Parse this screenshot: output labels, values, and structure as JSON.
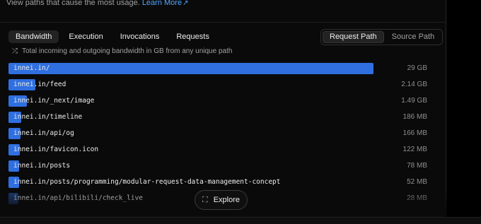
{
  "header": {
    "subtitle": "View paths that cause the most usage.",
    "learn_more": "Learn More",
    "external_icon": "external-link-icon"
  },
  "tabs": [
    {
      "label": "Bandwidth",
      "active": true
    },
    {
      "label": "Execution",
      "active": false
    },
    {
      "label": "Invocations",
      "active": false
    },
    {
      "label": "Requests",
      "active": false
    }
  ],
  "toggle": {
    "options": [
      {
        "label": "Request Path",
        "active": true
      },
      {
        "label": "Source Path",
        "active": false
      }
    ]
  },
  "description": {
    "icon": "shuffle-arrows-icon",
    "text": "Total incoming and outgoing bandwidth in GB from any unique path"
  },
  "accent_color": "#2f6fe0",
  "rows": [
    {
      "path": "innei.in/",
      "value": "29 GB",
      "share": 0.86
    },
    {
      "path": "innei.in/feed",
      "value": "2.14 GB",
      "share": 0.063
    },
    {
      "path": "innei.in/_next/image",
      "value": "1.49 GB",
      "share": 0.044
    },
    {
      "path": "innei.in/timeline",
      "value": "186 MB",
      "share": 0.03
    },
    {
      "path": "innei.in/api/og",
      "value": "166 MB",
      "share": 0.028
    },
    {
      "path": "innei.in/favicon.icon",
      "value": "122 MB",
      "share": 0.027
    },
    {
      "path": "innei.in/posts",
      "value": "78 MB",
      "share": 0.025
    },
    {
      "path": "innei.in/posts/programming/modular-request-data-management-concept",
      "value": "52 MB",
      "share": 0.025
    },
    {
      "path": "innei.in/api/bilibili/check_live",
      "value": "28 MB",
      "share": 0.024
    }
  ],
  "explore": {
    "label": "Explore",
    "icon": "expand-icon"
  }
}
